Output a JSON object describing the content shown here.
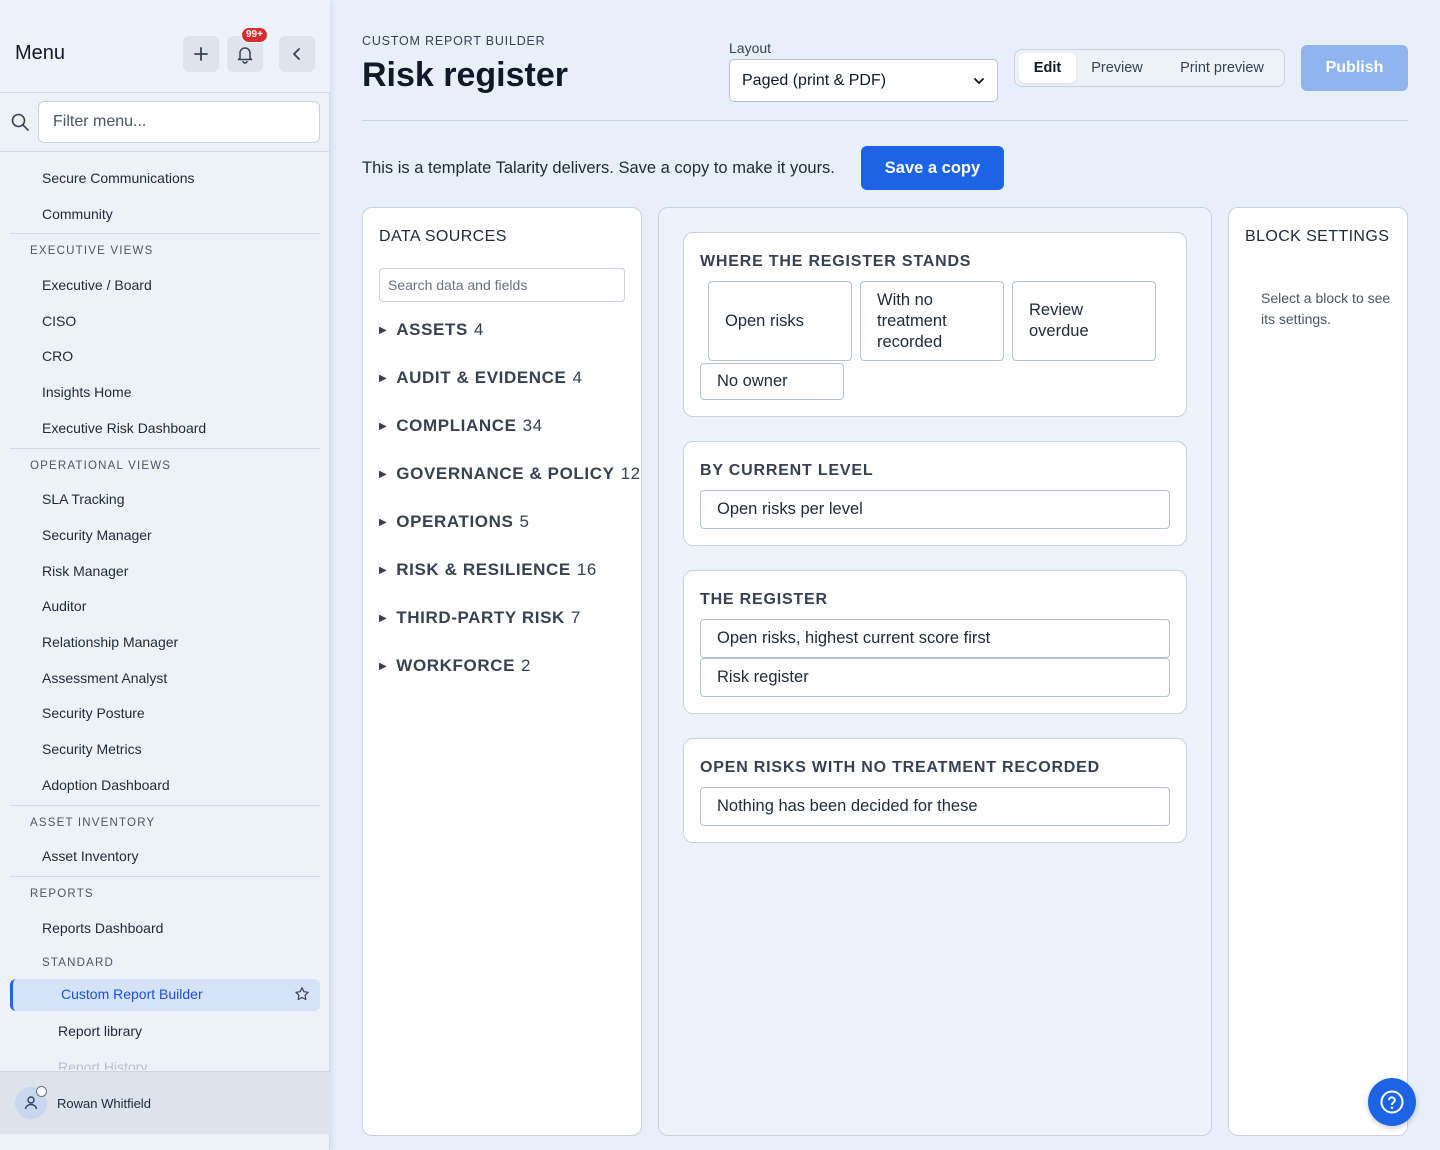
{
  "sidebar": {
    "title": "Menu",
    "notification_count": "99+",
    "filter_placeholder": "Filter menu...",
    "top_items": [
      "Secure Communications",
      "Community"
    ],
    "sections": {
      "executive": {
        "label": "EXECUTIVE VIEWS",
        "items": [
          "Executive / Board",
          "CISO",
          "CRO",
          "Insights Home",
          "Executive Risk Dashboard"
        ]
      },
      "operational": {
        "label": "OPERATIONAL VIEWS",
        "items": [
          "SLA Tracking",
          "Security Manager",
          "Risk Manager",
          "Auditor",
          "Relationship Manager",
          "Assessment Analyst",
          "Security Posture",
          "Security Metrics",
          "Adoption Dashboard"
        ]
      },
      "asset": {
        "label": "ASSET INVENTORY",
        "items": [
          "Asset Inventory"
        ]
      },
      "reports": {
        "label": "REPORTS",
        "items": [
          "Reports Dashboard"
        ],
        "sub_label": "STANDARD",
        "active_item": "Custom Report Builder",
        "sub_items": [
          "Report library",
          "Report History"
        ]
      }
    },
    "user_name": "Rowan Whitfield"
  },
  "header": {
    "eyebrow": "CUSTOM REPORT BUILDER",
    "title": "Risk register",
    "layout_label": "Layout",
    "layout_value": "Paged (print & PDF)",
    "modes": [
      "Edit",
      "Preview",
      "Print preview"
    ],
    "active_mode": "Edit",
    "publish_label": "Publish"
  },
  "notice": {
    "text": "This is a template Talarity delivers. Save a copy to make it yours.",
    "button": "Save a copy"
  },
  "data_sources": {
    "title": "DATA SOURCES",
    "search_placeholder": "Search data and fields",
    "groups": [
      {
        "name": "ASSETS",
        "count": "4"
      },
      {
        "name": "AUDIT & EVIDENCE",
        "count": "4"
      },
      {
        "name": "COMPLIANCE",
        "count": "34"
      },
      {
        "name": "GOVERNANCE & POLICY",
        "count": "12"
      },
      {
        "name": "OPERATIONS",
        "count": "5"
      },
      {
        "name": "RISK & RESILIENCE",
        "count": "16"
      },
      {
        "name": "THIRD-PARTY RISK",
        "count": "7"
      },
      {
        "name": "WORKFORCE",
        "count": "2"
      }
    ]
  },
  "canvas": {
    "blocks": [
      {
        "title": "WHERE THE REGISTER STANDS",
        "tiles": [
          "Open risks",
          "With no treatment recorded",
          "Review overdue",
          "No owner"
        ]
      },
      {
        "title": "BY CURRENT LEVEL",
        "tiles": [
          "Open risks per level"
        ]
      },
      {
        "title": "THE REGISTER",
        "tiles": [
          "Open risks, highest current score first",
          "Risk register"
        ]
      },
      {
        "title": "OPEN RISKS WITH NO TREATMENT RECORDED",
        "tiles": [
          "Nothing has been decided for these"
        ]
      }
    ]
  },
  "block_settings": {
    "title": "BLOCK SETTINGS",
    "hint": "Select a block to see its settings."
  },
  "colors": {
    "accent": "#1d63e6",
    "publish_disabled": "#8fb4ee",
    "badge": "#d32f2f",
    "active_nav_bg": "#d5e3f8"
  }
}
